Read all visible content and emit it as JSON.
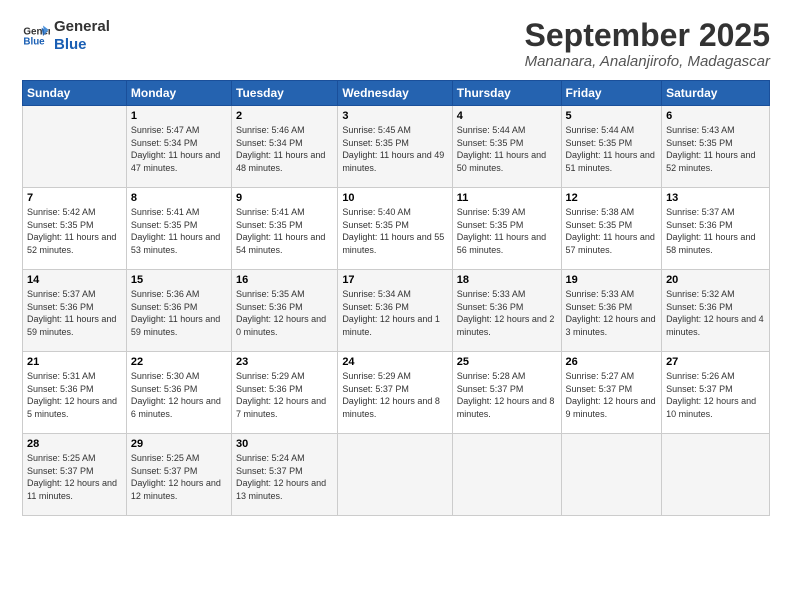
{
  "logo": {
    "line1": "General",
    "line2": "Blue"
  },
  "header": {
    "month": "September 2025",
    "location": "Mananara, Analanjirofo, Madagascar"
  },
  "weekdays": [
    "Sunday",
    "Monday",
    "Tuesday",
    "Wednesday",
    "Thursday",
    "Friday",
    "Saturday"
  ],
  "weeks": [
    [
      {
        "day": "",
        "sunrise": "",
        "sunset": "",
        "daylight": ""
      },
      {
        "day": "1",
        "sunrise": "Sunrise: 5:47 AM",
        "sunset": "Sunset: 5:34 PM",
        "daylight": "Daylight: 11 hours and 47 minutes."
      },
      {
        "day": "2",
        "sunrise": "Sunrise: 5:46 AM",
        "sunset": "Sunset: 5:34 PM",
        "daylight": "Daylight: 11 hours and 48 minutes."
      },
      {
        "day": "3",
        "sunrise": "Sunrise: 5:45 AM",
        "sunset": "Sunset: 5:35 PM",
        "daylight": "Daylight: 11 hours and 49 minutes."
      },
      {
        "day": "4",
        "sunrise": "Sunrise: 5:44 AM",
        "sunset": "Sunset: 5:35 PM",
        "daylight": "Daylight: 11 hours and 50 minutes."
      },
      {
        "day": "5",
        "sunrise": "Sunrise: 5:44 AM",
        "sunset": "Sunset: 5:35 PM",
        "daylight": "Daylight: 11 hours and 51 minutes."
      },
      {
        "day": "6",
        "sunrise": "Sunrise: 5:43 AM",
        "sunset": "Sunset: 5:35 PM",
        "daylight": "Daylight: 11 hours and 52 minutes."
      }
    ],
    [
      {
        "day": "7",
        "sunrise": "Sunrise: 5:42 AM",
        "sunset": "Sunset: 5:35 PM",
        "daylight": "Daylight: 11 hours and 52 minutes."
      },
      {
        "day": "8",
        "sunrise": "Sunrise: 5:41 AM",
        "sunset": "Sunset: 5:35 PM",
        "daylight": "Daylight: 11 hours and 53 minutes."
      },
      {
        "day": "9",
        "sunrise": "Sunrise: 5:41 AM",
        "sunset": "Sunset: 5:35 PM",
        "daylight": "Daylight: 11 hours and 54 minutes."
      },
      {
        "day": "10",
        "sunrise": "Sunrise: 5:40 AM",
        "sunset": "Sunset: 5:35 PM",
        "daylight": "Daylight: 11 hours and 55 minutes."
      },
      {
        "day": "11",
        "sunrise": "Sunrise: 5:39 AM",
        "sunset": "Sunset: 5:35 PM",
        "daylight": "Daylight: 11 hours and 56 minutes."
      },
      {
        "day": "12",
        "sunrise": "Sunrise: 5:38 AM",
        "sunset": "Sunset: 5:35 PM",
        "daylight": "Daylight: 11 hours and 57 minutes."
      },
      {
        "day": "13",
        "sunrise": "Sunrise: 5:37 AM",
        "sunset": "Sunset: 5:36 PM",
        "daylight": "Daylight: 11 hours and 58 minutes."
      }
    ],
    [
      {
        "day": "14",
        "sunrise": "Sunrise: 5:37 AM",
        "sunset": "Sunset: 5:36 PM",
        "daylight": "Daylight: 11 hours and 59 minutes."
      },
      {
        "day": "15",
        "sunrise": "Sunrise: 5:36 AM",
        "sunset": "Sunset: 5:36 PM",
        "daylight": "Daylight: 11 hours and 59 minutes."
      },
      {
        "day": "16",
        "sunrise": "Sunrise: 5:35 AM",
        "sunset": "Sunset: 5:36 PM",
        "daylight": "Daylight: 12 hours and 0 minutes."
      },
      {
        "day": "17",
        "sunrise": "Sunrise: 5:34 AM",
        "sunset": "Sunset: 5:36 PM",
        "daylight": "Daylight: 12 hours and 1 minute."
      },
      {
        "day": "18",
        "sunrise": "Sunrise: 5:33 AM",
        "sunset": "Sunset: 5:36 PM",
        "daylight": "Daylight: 12 hours and 2 minutes."
      },
      {
        "day": "19",
        "sunrise": "Sunrise: 5:33 AM",
        "sunset": "Sunset: 5:36 PM",
        "daylight": "Daylight: 12 hours and 3 minutes."
      },
      {
        "day": "20",
        "sunrise": "Sunrise: 5:32 AM",
        "sunset": "Sunset: 5:36 PM",
        "daylight": "Daylight: 12 hours and 4 minutes."
      }
    ],
    [
      {
        "day": "21",
        "sunrise": "Sunrise: 5:31 AM",
        "sunset": "Sunset: 5:36 PM",
        "daylight": "Daylight: 12 hours and 5 minutes."
      },
      {
        "day": "22",
        "sunrise": "Sunrise: 5:30 AM",
        "sunset": "Sunset: 5:36 PM",
        "daylight": "Daylight: 12 hours and 6 minutes."
      },
      {
        "day": "23",
        "sunrise": "Sunrise: 5:29 AM",
        "sunset": "Sunset: 5:36 PM",
        "daylight": "Daylight: 12 hours and 7 minutes."
      },
      {
        "day": "24",
        "sunrise": "Sunrise: 5:29 AM",
        "sunset": "Sunset: 5:37 PM",
        "daylight": "Daylight: 12 hours and 8 minutes."
      },
      {
        "day": "25",
        "sunrise": "Sunrise: 5:28 AM",
        "sunset": "Sunset: 5:37 PM",
        "daylight": "Daylight: 12 hours and 8 minutes."
      },
      {
        "day": "26",
        "sunrise": "Sunrise: 5:27 AM",
        "sunset": "Sunset: 5:37 PM",
        "daylight": "Daylight: 12 hours and 9 minutes."
      },
      {
        "day": "27",
        "sunrise": "Sunrise: 5:26 AM",
        "sunset": "Sunset: 5:37 PM",
        "daylight": "Daylight: 12 hours and 10 minutes."
      }
    ],
    [
      {
        "day": "28",
        "sunrise": "Sunrise: 5:25 AM",
        "sunset": "Sunset: 5:37 PM",
        "daylight": "Daylight: 12 hours and 11 minutes."
      },
      {
        "day": "29",
        "sunrise": "Sunrise: 5:25 AM",
        "sunset": "Sunset: 5:37 PM",
        "daylight": "Daylight: 12 hours and 12 minutes."
      },
      {
        "day": "30",
        "sunrise": "Sunrise: 5:24 AM",
        "sunset": "Sunset: 5:37 PM",
        "daylight": "Daylight: 12 hours and 13 minutes."
      },
      {
        "day": "",
        "sunrise": "",
        "sunset": "",
        "daylight": ""
      },
      {
        "day": "",
        "sunrise": "",
        "sunset": "",
        "daylight": ""
      },
      {
        "day": "",
        "sunrise": "",
        "sunset": "",
        "daylight": ""
      },
      {
        "day": "",
        "sunrise": "",
        "sunset": "",
        "daylight": ""
      }
    ]
  ]
}
